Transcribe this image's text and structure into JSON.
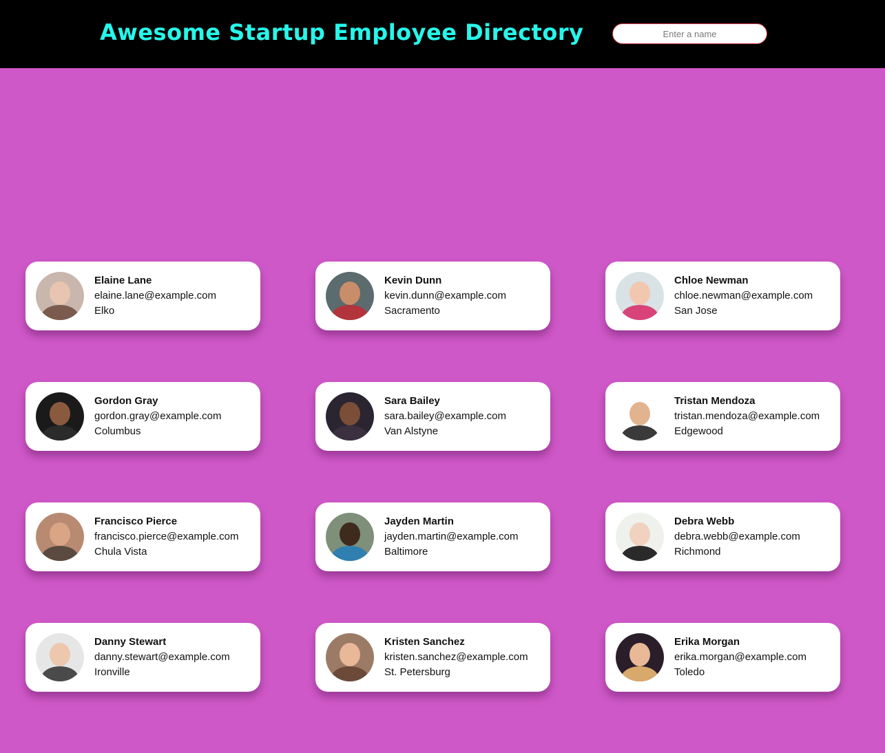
{
  "header": {
    "title": "Awesome Startup Employee Directory",
    "search_placeholder": "Enter a name",
    "background": "#000000",
    "title_color": "#27f6ea"
  },
  "page": {
    "background": "#cf58c8"
  },
  "employees": [
    {
      "name": "Elaine Lane",
      "email": "elaine.lane@example.com",
      "city": "Elko",
      "avatar_bg": "#c9b7ad",
      "skin": "#e8c5b0",
      "shirt": "#7a5b4d"
    },
    {
      "name": "Kevin Dunn",
      "email": "kevin.dunn@example.com",
      "city": "Sacramento",
      "avatar_bg": "#5c6b6e",
      "skin": "#c98d6a",
      "shirt": "#b3343c"
    },
    {
      "name": "Chloe Newman",
      "email": "chloe.newman@example.com",
      "city": "San Jose",
      "avatar_bg": "#d9e2e4",
      "skin": "#f1c7b0",
      "shirt": "#d8437a"
    },
    {
      "name": "Gordon Gray",
      "email": "gordon.gray@example.com",
      "city": "Columbus",
      "avatar_bg": "#1a1a1a",
      "skin": "#8a5a3f",
      "shirt": "#2b2b2b"
    },
    {
      "name": "Sara Bailey",
      "email": "sara.bailey@example.com",
      "city": "Van Alstyne",
      "avatar_bg": "#2a2530",
      "skin": "#7a4e37",
      "shirt": "#3a3040"
    },
    {
      "name": "Tristan Mendoza",
      "email": "tristan.mendoza@example.com",
      "city": "Edgewood",
      "avatar_bg": "#ffffff",
      "skin": "#e2b38f",
      "shirt": "#3a3a3a"
    },
    {
      "name": "Francisco Pierce",
      "email": "francisco.pierce@example.com",
      "city": "Chula Vista",
      "avatar_bg": "#b98a72",
      "skin": "#d9a584",
      "shirt": "#5a4a3f"
    },
    {
      "name": "Jayden Martin",
      "email": "jayden.martin@example.com",
      "city": "Baltimore",
      "avatar_bg": "#7e8f7a",
      "skin": "#3f2a1e",
      "shirt": "#2f7fb0"
    },
    {
      "name": "Debra Webb",
      "email": "debra.webb@example.com",
      "city": "Richmond",
      "avatar_bg": "#eff1ec",
      "skin": "#f0d2bf",
      "shirt": "#2a2a2a"
    },
    {
      "name": "Danny Stewart",
      "email": "danny.stewart@example.com",
      "city": "Ironville",
      "avatar_bg": "#e6e6e6",
      "skin": "#edc7ae",
      "shirt": "#4a4a4a"
    },
    {
      "name": "Kristen Sanchez",
      "email": "kristen.sanchez@example.com",
      "city": "St. Petersburg",
      "avatar_bg": "#9c7b66",
      "skin": "#e9b898",
      "shirt": "#6b4a3a"
    },
    {
      "name": "Erika Morgan",
      "email": "erika.morgan@example.com",
      "city": "Toledo",
      "avatar_bg": "#2a1e2a",
      "skin": "#e9b896",
      "shirt": "#d9a86b"
    }
  ]
}
